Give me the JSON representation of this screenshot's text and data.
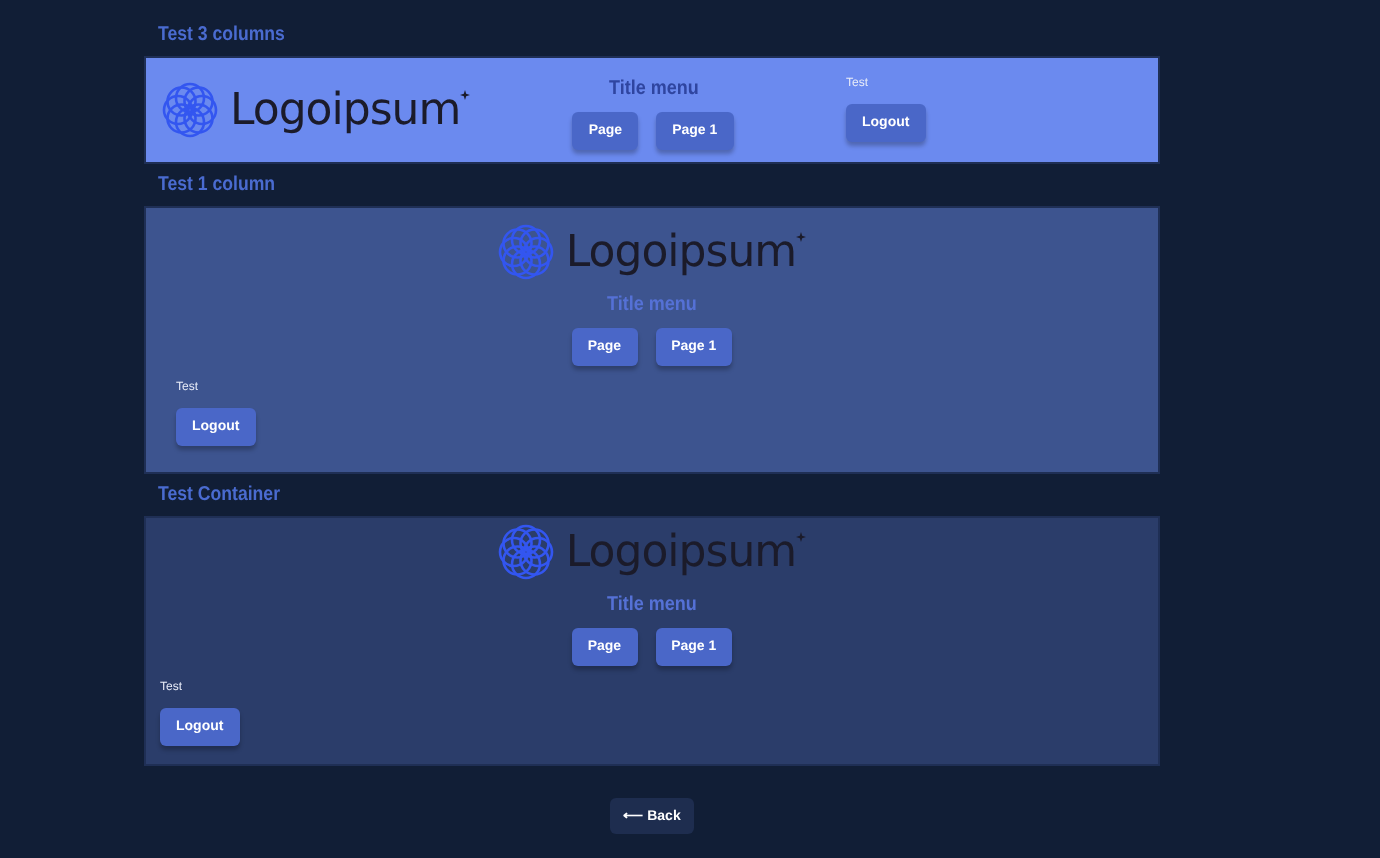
{
  "sections": [
    {
      "kind": "columns3",
      "title": "Test 3 columns",
      "logo": "Logoipsum",
      "menu_title": "Title menu",
      "menu_buttons": [
        "Page",
        "Page 1"
      ],
      "user_label": "Test",
      "logout": "Logout"
    },
    {
      "kind": "column1",
      "title": "Test 1 column",
      "logo": "Logoipsum",
      "menu_title": "Title menu",
      "menu_buttons": [
        "Page",
        "Page 1"
      ],
      "user_label": "Test",
      "logout": "Logout"
    },
    {
      "kind": "container",
      "title": "Test Container",
      "logo": "Logoipsum",
      "menu_title": "Title menu",
      "menu_buttons": [
        "Page",
        "Page 1"
      ],
      "user_label": "Test",
      "logout": "Logout"
    }
  ],
  "back_button": "⟵ Back"
}
